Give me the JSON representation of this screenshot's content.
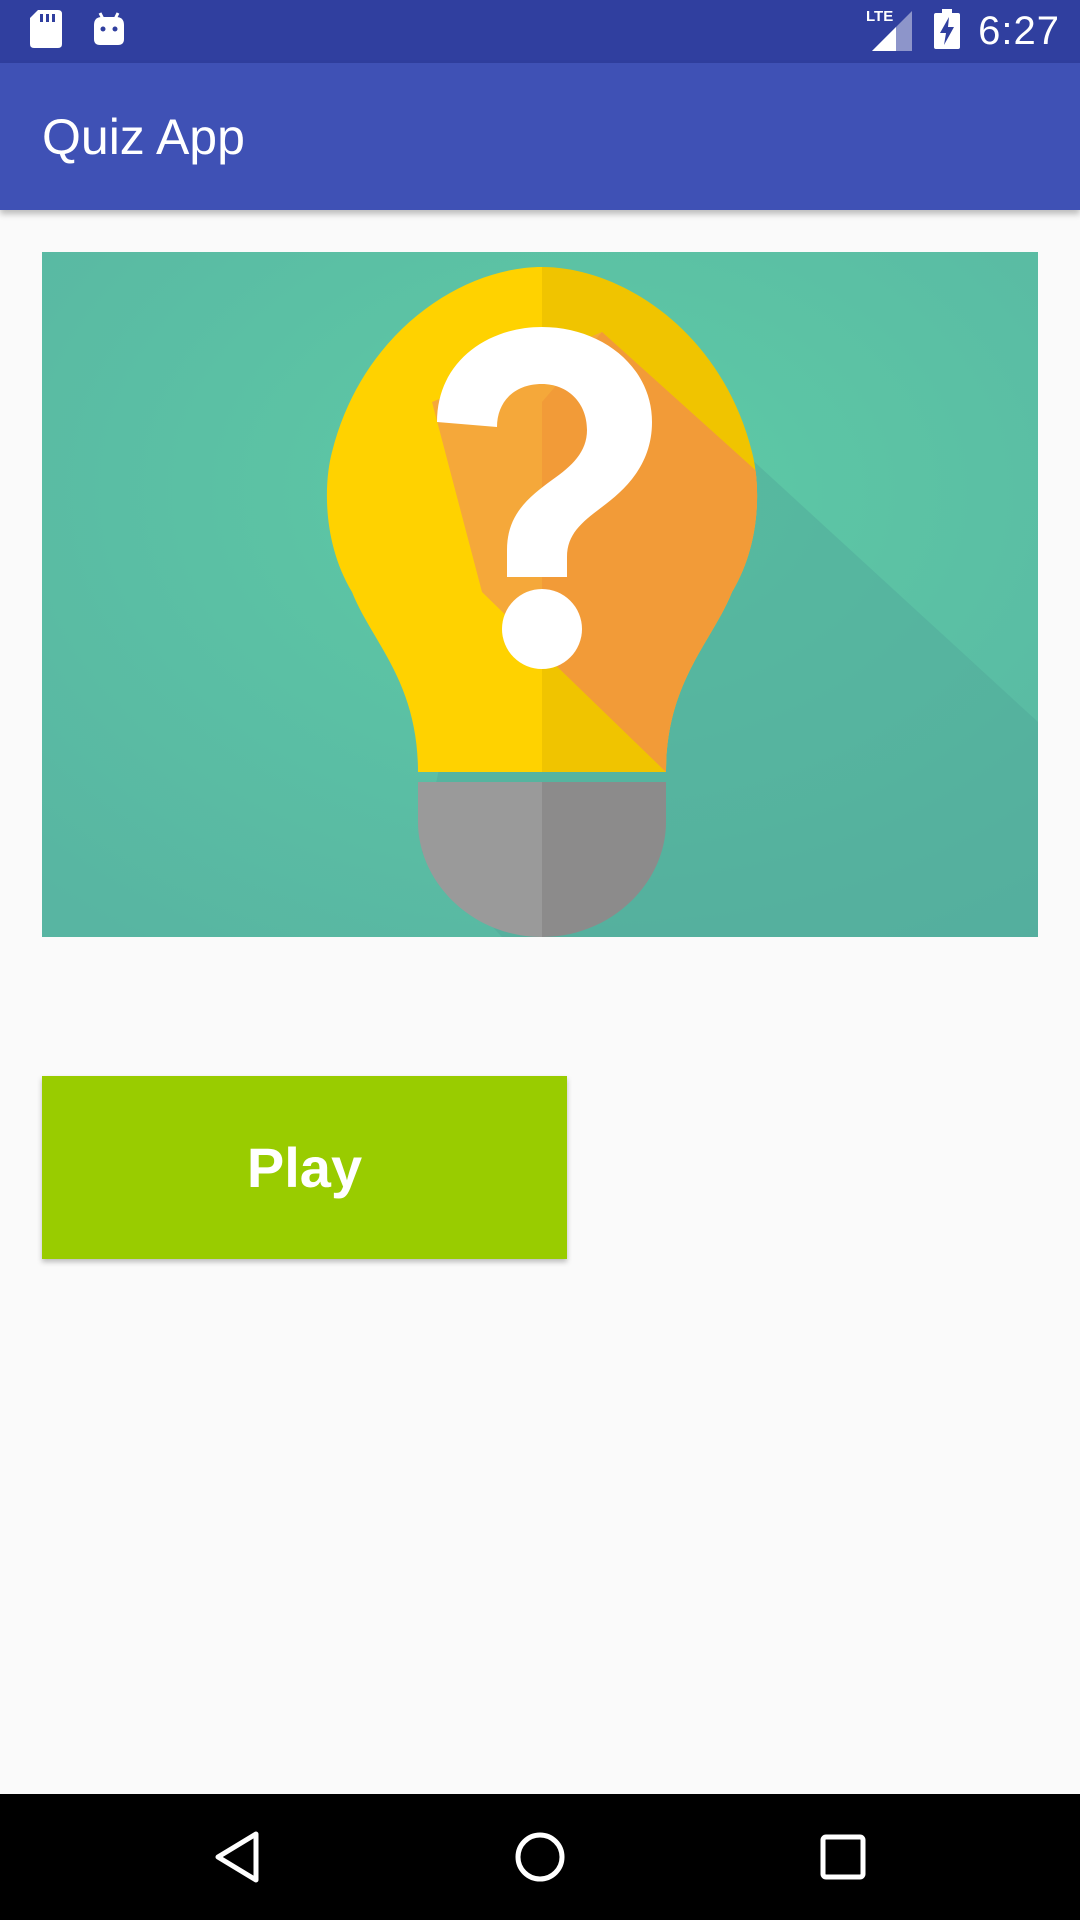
{
  "status_bar": {
    "time": "6:27",
    "network_label": "LTE",
    "icons": [
      "sd-card-icon",
      "android-icon",
      "lte-signal-icon",
      "battery-charging-icon"
    ]
  },
  "app_bar": {
    "title": "Quiz App"
  },
  "hero": {
    "icon": "lightbulb-question-icon"
  },
  "main": {
    "play_label": "Play"
  },
  "nav_bar": {
    "icons": [
      "back-icon",
      "home-icon",
      "recents-icon"
    ]
  },
  "colors": {
    "status_bar": "#303f9f",
    "app_bar": "#3f51b5",
    "play_button": "#99cc00",
    "background": "#fafafa",
    "hero_bg": "#5ec8a8",
    "bulb_yellow": "#ffd200",
    "bulb_orange": "#f4a03a",
    "bulb_base": "#9a9a9a"
  }
}
